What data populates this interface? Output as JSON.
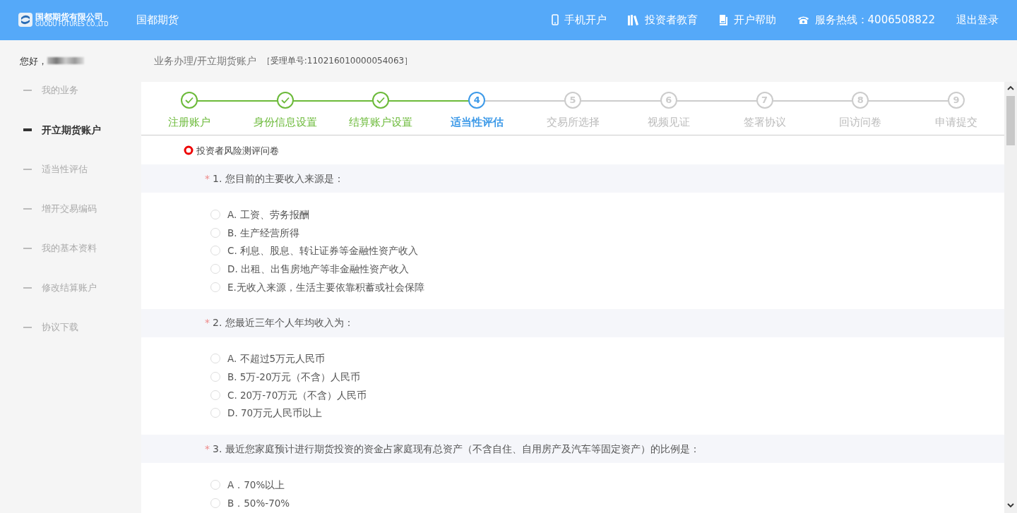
{
  "header": {
    "logo": {
      "name": "国都期货有限公司",
      "subtitle": "GUODU FUTURES CO.,LTD"
    },
    "site_title": "国都期货",
    "links": [
      {
        "kind": "mobile",
        "label": "手机开户"
      },
      {
        "kind": "books",
        "label": "投资者教育"
      },
      {
        "kind": "help",
        "label": "开户帮助"
      },
      {
        "kind": "phone",
        "label": "服务热线：4006508822"
      },
      {
        "kind": "plain",
        "label": "退出登录"
      }
    ]
  },
  "sidebar": {
    "greeting": "您好，",
    "items": [
      {
        "label": "我的业务",
        "selected": false
      },
      {
        "label": "开立期货账户",
        "selected": true
      },
      {
        "label": "适当性评估",
        "selected": false
      },
      {
        "label": "增开交易编码",
        "selected": false
      },
      {
        "label": "我的基本资料",
        "selected": false
      },
      {
        "label": "修改结算账户",
        "selected": false
      },
      {
        "label": "协议下载",
        "selected": false
      }
    ]
  },
  "breadcrumb": {
    "path": "业务办理/开立期货账户",
    "ticket": "［受理单号:110216010000054063］"
  },
  "steps": [
    {
      "label": "注册账户",
      "done": true,
      "selected": false
    },
    {
      "label": "身份信息设置",
      "done": true,
      "selected": false
    },
    {
      "label": "结算账户设置",
      "done": true,
      "selected": false
    },
    {
      "number": "4",
      "label": "适当性评估",
      "done": false,
      "selected": true
    },
    {
      "number": "5",
      "label": "交易所选择",
      "done": false,
      "selected": false
    },
    {
      "number": "6",
      "label": "视频见证",
      "done": false,
      "selected": false
    },
    {
      "number": "7",
      "label": "签署协议",
      "done": false,
      "selected": false
    },
    {
      "number": "8",
      "label": "回访问卷",
      "done": false,
      "selected": false
    },
    {
      "number": "9",
      "label": "申请提交",
      "done": false,
      "selected": false
    }
  ],
  "survey": {
    "title": "投资者风险测评问卷",
    "questions": [
      {
        "required_mark": "*",
        "text": "1. 您目前的主要收入来源是：",
        "options": [
          {
            "label": "A. 工资、劳务报酬",
            "selected": false
          },
          {
            "label": "B. 生产经营所得",
            "selected": false
          },
          {
            "label": "C. 利息、股息、转让证券等金融性资产收入",
            "selected": false
          },
          {
            "label": "D. 出租、出售房地产等非金融性资产收入",
            "selected": false
          },
          {
            "label": "E.无收入来源，生活主要依靠积蓄或社会保障",
            "selected": false
          }
        ]
      },
      {
        "required_mark": "*",
        "text": "2. 您最近三年个人年均收入为：",
        "options": [
          {
            "label": "A. 不超过5万元人民币",
            "selected": false
          },
          {
            "label": "B. 5万-20万元（不含）人民币",
            "selected": false
          },
          {
            "label": "C. 20万-70万元（不含）人民币",
            "selected": false
          },
          {
            "label": "D. 70万元人民币以上",
            "selected": false
          }
        ]
      },
      {
        "required_mark": "*",
        "text": "3. 最近您家庭预计进行期货投资的资金占家庭现有总资产（不含自住、自用房产及汽车等固定资产）的比例是：",
        "options": [
          {
            "label": "A．70%以上",
            "selected": false
          },
          {
            "label": "B．50%-70%",
            "selected": false
          }
        ]
      }
    ]
  }
}
